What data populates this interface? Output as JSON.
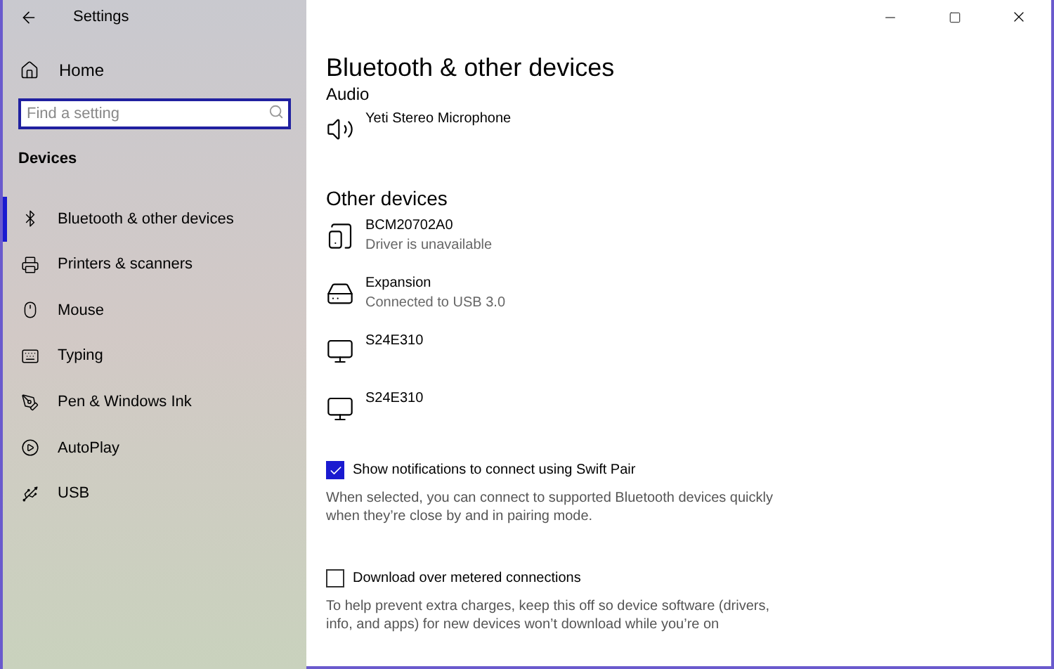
{
  "window": {
    "title": "Settings"
  },
  "sidebar": {
    "home": "Home",
    "search": {
      "placeholder": "Find a setting"
    },
    "section": "Devices",
    "items": [
      {
        "label": "Bluetooth & other devices",
        "kind": "bluetooth",
        "selected": true
      },
      {
        "label": "Printers & scanners",
        "kind": "printer",
        "selected": false
      },
      {
        "label": "Mouse",
        "kind": "mouse",
        "selected": false
      },
      {
        "label": "Typing",
        "kind": "keyboard",
        "selected": false
      },
      {
        "label": "Pen & Windows Ink",
        "kind": "pen",
        "selected": false
      },
      {
        "label": "AutoPlay",
        "kind": "autoplay",
        "selected": false
      },
      {
        "label": "USB",
        "kind": "usb",
        "selected": false
      }
    ]
  },
  "page": {
    "title": "Bluetooth & other devices",
    "sections": [
      {
        "heading": "Audio",
        "devices": [
          {
            "name": "Yeti Stereo Microphone",
            "kind": "speaker"
          }
        ]
      },
      {
        "heading": "Other devices",
        "devices": [
          {
            "name": "BCM20702A0",
            "status": "Driver is unavailable",
            "kind": "device"
          },
          {
            "name": "Expansion",
            "status": "Connected to USB 3.0",
            "kind": "drive"
          },
          {
            "name": "S24E310",
            "kind": "monitor"
          },
          {
            "name": "S24E310",
            "kind": "monitor"
          }
        ]
      }
    ],
    "options": [
      {
        "label": "Show notifications to connect using Swift Pair",
        "checked": true,
        "description": "When selected, you can connect to supported Bluetooth devices quickly when they’re close by and in pairing mode."
      },
      {
        "label": "Download over metered connections",
        "checked": false,
        "description": "To help prevent extra charges, keep this off so device software (drivers, info, and apps) for new devices won’t download while you’re on"
      }
    ]
  }
}
